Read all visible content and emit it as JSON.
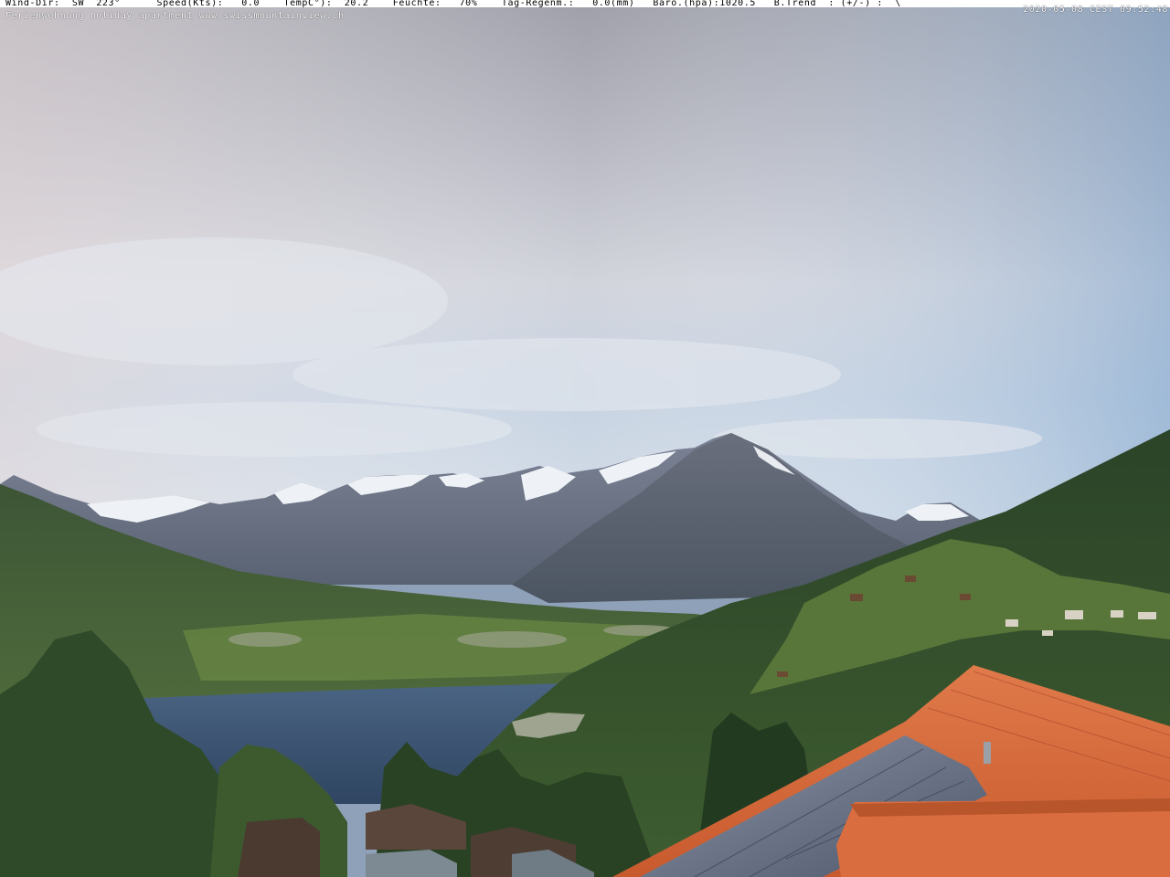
{
  "overlay": {
    "weather_line": "Wind-Dir:  SW  223°      Speed(Kts):   0.0    TempC°):  20.2    Feuchte:   70%    Tag-Regenm.:   0.0(mm)   Baro.(hpa):1020.5   B.Trend  : (+/-) :  \\",
    "credit_line": "Ferienwohnung holiday apartment www.swissmountainview.ch",
    "timestamp": "2020-05-08 CEST 09:52:48"
  },
  "colors": {
    "sky_top": "#a8a9b3",
    "sky_mid": "#c9ccd6",
    "sky_blue": "#8fb2d6",
    "lake": "#3a5370",
    "mountain": "#5c6373",
    "snow": "#eef2f6",
    "forest": "#2f4a2a",
    "meadow": "#5f7d3d",
    "roof_tile": "#d86a3c",
    "solar_panel": "#6b7689"
  }
}
